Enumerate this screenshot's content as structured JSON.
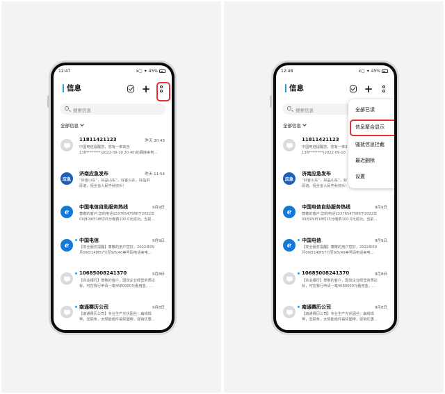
{
  "left": {
    "status_time": "12:47",
    "status_icons": "ⅹ▢ ✦ 45%",
    "header": {
      "title": "信息"
    },
    "search": {
      "placeholder": "搜索信息"
    },
    "filter_label": "全部信息",
    "messages": [
      {
        "name": "11811421123",
        "time": "昨天 20:43",
        "line1": "中国电信提醒您，您有一条来自",
        "line2": "138********(2022-09-10 20:40)的漏接来电…",
        "avatar": "gray",
        "unread": false
      },
      {
        "name": "济南应急发布",
        "time": "昨天 11:54",
        "line1": "“好客山东”，好品山东”，好客山东，好品供",
        "line2": "厚道，祝全省人民中秋快乐！",
        "avatar": "emergency",
        "avatar_text": "应急",
        "unread": false
      },
      {
        "name": "中国电信自助服务热线",
        "time": "9月9日",
        "line1": "尊敬的客户:您的电话15376547586于2022年",
        "line2": "09月09日18时15分缴费100.0元成功。当前…",
        "avatar": "telecom",
        "unread": true
      },
      {
        "name": "中国电信",
        "time": "9月9日",
        "line1": "【安全服务提醒】尊敬的用户您好，2022年09",
        "line2": "月09日14时57分至9/5/40美号码电话来电…",
        "avatar": "telecom",
        "unread": true
      },
      {
        "name": "10685008241370",
        "time": "9月8日",
        "line1": "【农业银行】尊敬的客户，因您企业经营资质达",
        "line2": "标，可在我行申请一笔4680000元看用金，…",
        "avatar": "gray",
        "unread": true
      },
      {
        "name": "南通赛历公司",
        "time": "9月8日",
        "line1": "【南通赛历公司】专业生产光伏固丝，扁线焊",
        "line2": "带，互联条，太阳能组件锻焊固带，促销优惠…",
        "avatar": "gray",
        "unread": true
      }
    ]
  },
  "right": {
    "status_time": "12:48",
    "status_icons": "ⅹ▢ ✦ 45%",
    "header": {
      "title": "信息"
    },
    "search": {
      "placeholder": "搜索信息"
    },
    "filter_label": "全部信息",
    "menu": [
      "全部已读",
      "信息聚合显示",
      "骚扰信息拦截",
      "最近删除",
      "设置"
    ],
    "messages": [
      {
        "name": "11811421123",
        "line1": "中国电信提醒您，您有一条来自",
        "line2": "138********(2022-09-10 20:40)的漏接来…",
        "avatar": "gray",
        "unread": false
      },
      {
        "name": "济南应急发布",
        "line1": "“好客山东”，好品山东”，好客山东，好品供",
        "line2": "厚道，祝全省人民中秋快乐！",
        "avatar": "emergency",
        "avatar_text": "应急",
        "unread": false
      },
      {
        "name": "中国电信自助服务热线",
        "time": "9月9日",
        "line1": "尊敬的客户:您的电话15376547586于2022年",
        "line2": "09月09日18时15分缴费100.0元成功。当前…",
        "avatar": "telecom",
        "unread": true
      },
      {
        "name": "中国电信",
        "time": "9月9日",
        "line1": "【安全服务提醒】尊敬的用户您好，2022年09",
        "line2": "月09日14时57分至9/5/40美号码电话来电…",
        "avatar": "telecom",
        "unread": true
      },
      {
        "name": "10685008241370",
        "time": "9月8日",
        "line1": "【农业银行】尊敬的客户，因您企业经营资质达",
        "line2": "标，可在我行申请一笔4680000元看用金，…",
        "avatar": "gray",
        "unread": true
      },
      {
        "name": "南通赛历公司",
        "time": "9月8日",
        "line1": "【南通赛历公司】专业生产光伏固丝，扁线焊",
        "line2": "带，互联条，太阳能组件锻焊固带，促销优惠…",
        "avatar": "gray",
        "unread": true
      }
    ]
  },
  "colors": {
    "accent": "#2f9be6",
    "highlight": "#e53035",
    "telecom": "#1577d6",
    "emergency": "#1e5fb8"
  }
}
